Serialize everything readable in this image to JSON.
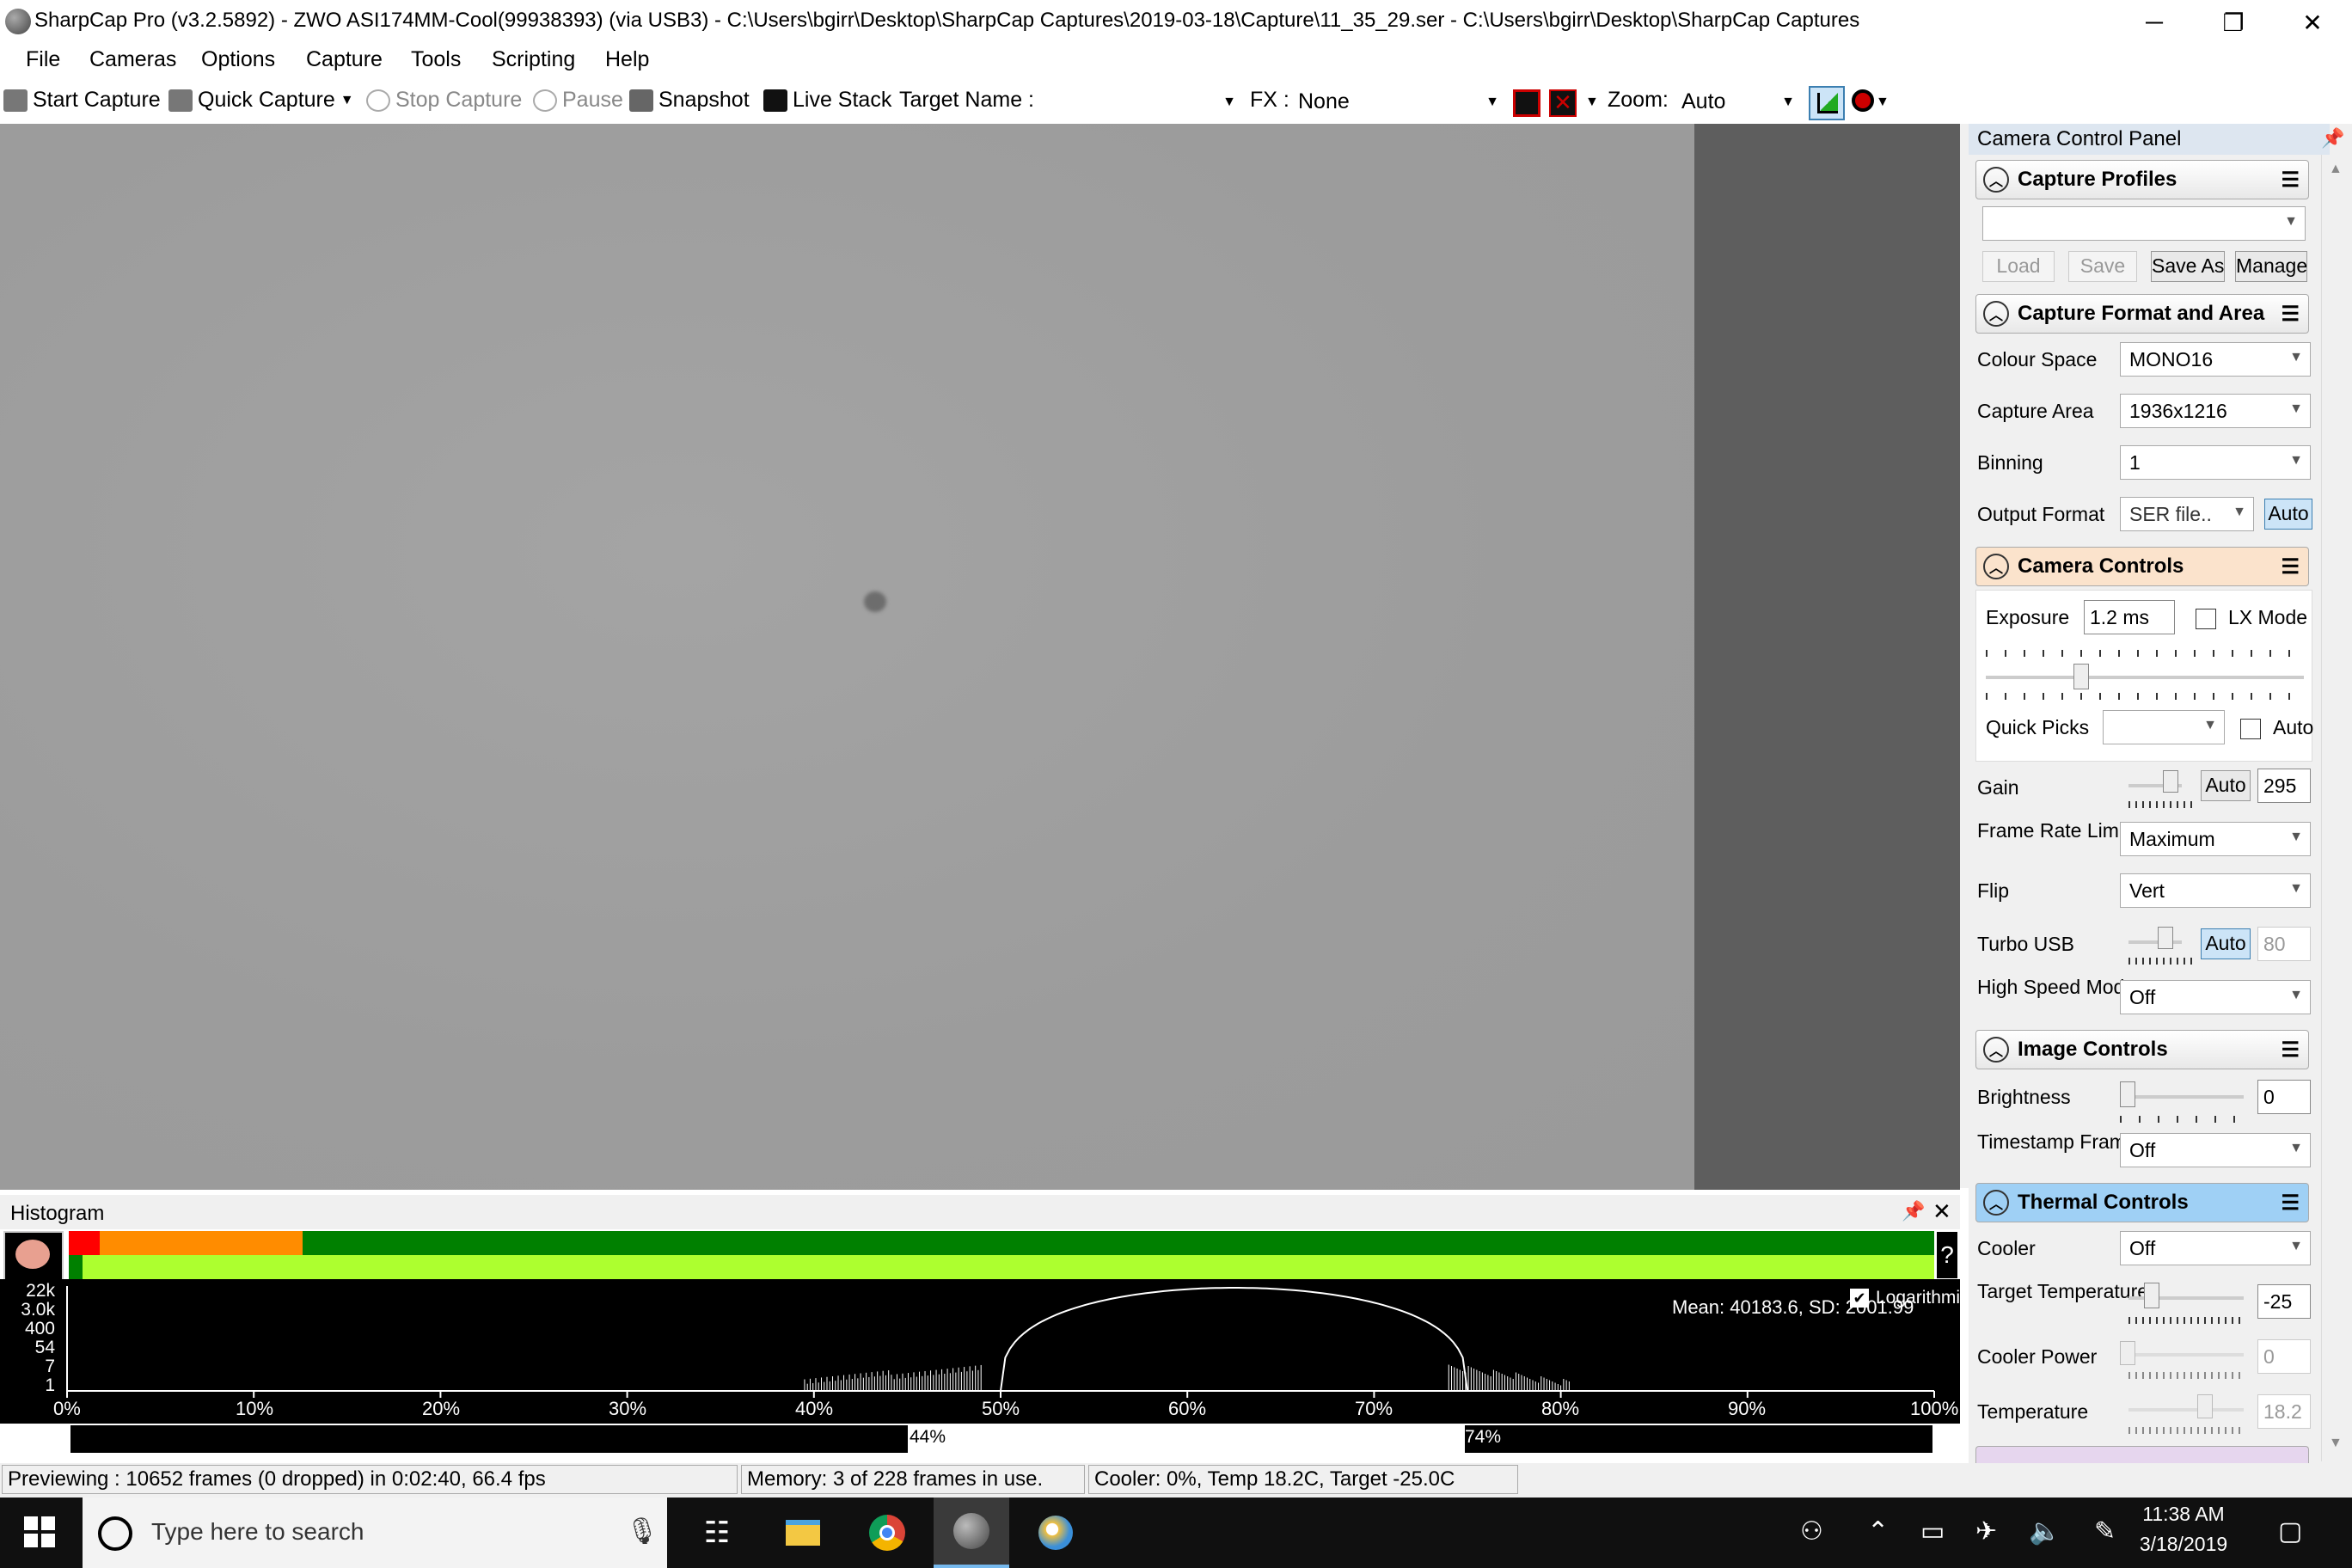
{
  "title_bar": {
    "title": "SharpCap Pro (v3.2.5892) - ZWO ASI174MM-Cool(99938393) (via USB3) - C:\\Users\\bgirr\\Desktop\\SharpCap Captures\\2019-03-18\\Capture\\11_35_29.ser - C:\\Users\\bgirr\\Desktop\\SharpCap Captures",
    "minimize": "─",
    "maximize": "❐",
    "close": "✕"
  },
  "menu": [
    "File",
    "Cameras",
    "Options",
    "Capture",
    "Tools",
    "Scripting",
    "Help"
  ],
  "toolbar": {
    "start_capture": "Start Capture",
    "quick_capture": "Quick Capture",
    "stop_capture": "Stop Capture",
    "pause": "Pause",
    "snapshot": "Snapshot",
    "live_stack": "Live Stack",
    "target_name_label": "Target Name :",
    "target_name_value": "",
    "fx_label": "FX :",
    "fx_value": "None",
    "zoom_label": "Zoom:",
    "zoom_value": "Auto"
  },
  "histogram": {
    "title": "Histogram",
    "y_ticks": [
      "22k",
      "3.0k",
      "400",
      "54",
      "7",
      "1"
    ],
    "x_ticks": [
      "0%",
      "10%",
      "20%",
      "30%",
      "40%",
      "50%",
      "60%",
      "70%",
      "80%",
      "90%",
      "100%"
    ],
    "logarithmic_label": "Logarithmic",
    "logarithmic_checked": true,
    "mean_text": "Mean: 40183.6, SD: 2001.99",
    "range_low": "44%",
    "range_high": "74%",
    "help": "?"
  },
  "status": {
    "previewing": "Previewing : 10652 frames (0 dropped) in 0:02:40, 66.4 fps",
    "memory": "Memory: 3 of 228 frames in use.",
    "cooler": "Cooler: 0%, Temp 18.2C, Target -25.0C"
  },
  "panel": {
    "title": "Camera Control Panel",
    "capture_profiles": {
      "header": "Capture Profiles",
      "profile_value": "",
      "load": "Load",
      "save": "Save",
      "save_as": "Save As",
      "manage": "Manage"
    },
    "format": {
      "header": "Capture Format and Area",
      "colour_space_label": "Colour Space",
      "colour_space": "MONO16",
      "capture_area_label": "Capture Area",
      "capture_area": "1936x1216",
      "binning_label": "Binning",
      "binning": "1",
      "output_format_label": "Output Format",
      "output_format": "SER file..",
      "output_auto": "Auto"
    },
    "camera": {
      "header": "Camera Controls",
      "exposure_label": "Exposure",
      "exposure": "1.2 ms",
      "lx_mode": "LX Mode",
      "quick_picks_label": "Quick Picks",
      "quick_picks_auto": "Auto",
      "gain_label": "Gain",
      "gain_auto": "Auto",
      "gain": "295",
      "frame_rate_label": "Frame Rate Limit",
      "frame_rate": "Maximum",
      "flip_label": "Flip",
      "flip": "Vert",
      "turbo_label": "Turbo USB",
      "turbo_auto": "Auto",
      "turbo": "80",
      "hsm_label": "High Speed Mode",
      "hsm": "Off"
    },
    "image": {
      "header": "Image Controls",
      "brightness_label": "Brightness",
      "brightness": "0",
      "timestamp_label": "Timestamp Frames",
      "timestamp": "Off"
    },
    "thermal": {
      "header": "Thermal Controls",
      "cooler_label": "Cooler",
      "cooler": "Off",
      "target_label": "Target Temperature",
      "target": "-25",
      "power_label": "Cooler Power",
      "power": "0",
      "temp_label": "Temperature",
      "temp": "18.2"
    }
  },
  "taskbar": {
    "search_placeholder": "Type here to search",
    "time": "11:38 AM",
    "date": "3/18/2019"
  },
  "colors": {
    "histogram_red": "#ff0000",
    "histogram_orange": "#ff8c00",
    "histogram_green": "#008000",
    "histogram_lime": "#adff2f",
    "thermal_header": "#9fd0f5",
    "camera_header": "#fbe3cc"
  }
}
